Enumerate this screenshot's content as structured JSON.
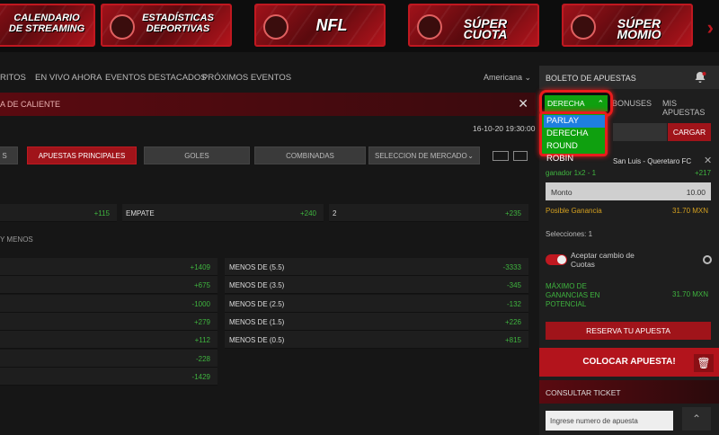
{
  "banners": [
    {
      "line1": "CALENDARIO",
      "line2": "DE STREAMING"
    },
    {
      "line1": "ESTADÍSTICAS",
      "line2": "DEPORTIVAS"
    },
    {
      "line1": "NFL",
      "line2": ""
    },
    {
      "line1": "SÚPER CUOTA",
      "line2": ""
    },
    {
      "line1": "SÚPER MOMIO",
      "line2": ""
    }
  ],
  "nav": {
    "items": [
      "RITOS",
      "EN VIVO AHORA",
      "EVENTOS DESTACADOS",
      "PRÓXIMOS EVENTOS"
    ],
    "odds_format": "Americana"
  },
  "event_bar": {
    "label": "A DE CALIENTE"
  },
  "event": {
    "datetime": "16-10-20 19:30:00"
  },
  "market_tabs": [
    "S",
    "APUESTAS PRINCIPALES",
    "GOLES",
    "COMBINADAS",
    "SELECCION DE MERCADO"
  ],
  "match_result": {
    "odd1": "+115",
    "draw_label": "EMPATE",
    "draw_odd": "+240",
    "label2": "2",
    "odd2": "+235"
  },
  "totals_section": "Y MENOS",
  "totals": [
    {
      "left_odd": "+1409",
      "label": "MENOS DE (5.5)",
      "right_odd": "-3333"
    },
    {
      "left_odd": "+675",
      "label": "MENOS DE (3.5)",
      "right_odd": "-345"
    },
    {
      "left_odd": "-1000",
      "label": "MENOS DE (2.5)",
      "right_odd": "-132"
    },
    {
      "left_odd": "+279",
      "label": "MENOS DE (1.5)",
      "right_odd": "+226"
    },
    {
      "left_odd": "+112",
      "label": "MENOS DE (0.5)",
      "right_odd": "+815"
    },
    {
      "left_odd": "-228",
      "label": "",
      "right_odd": ""
    },
    {
      "left_odd": "-1429",
      "label": "",
      "right_odd": ""
    }
  ],
  "slip": {
    "title": "BOLETO DE APUESTAS",
    "tabs": [
      "BONUSES",
      "MIS APUESTAS"
    ],
    "dropdown": {
      "selected": "DERECHA",
      "options": [
        "PARLAY",
        "DERECHA",
        "ROUND ROBIN"
      ],
      "highlighted": "PARLAY"
    },
    "load_button": "CARGAR",
    "bet": {
      "title": "San Luis - Queretaro FC",
      "type": "ganador 1x2 - 1",
      "odd": "+217"
    },
    "stake_label": "Monto",
    "stake_value": "10.00",
    "possible_win_label": "Posible Ganancia",
    "possible_win_value": "31.70 MXN",
    "selections": "Selecciones: 1",
    "accept_change": "Aceptar cambio de Cuotas",
    "max_win_label": "MÁXIMO DE GANANCIAS EN POTENCIAL",
    "max_win_value": "31.70 MXN",
    "reserve_button": "RESERVA TU APUESTA",
    "place_button": "COLOCAR APUESTA!",
    "consult_ticket": "CONSULTAR TICKET",
    "ticket_placeholder": "Ingrese numero de apuesta"
  },
  "colors": {
    "accent": "#c01820",
    "odds_green": "#3fb43f",
    "dropdown_green": "#0fa00f",
    "highlight_blue": "#1e7fe0"
  }
}
